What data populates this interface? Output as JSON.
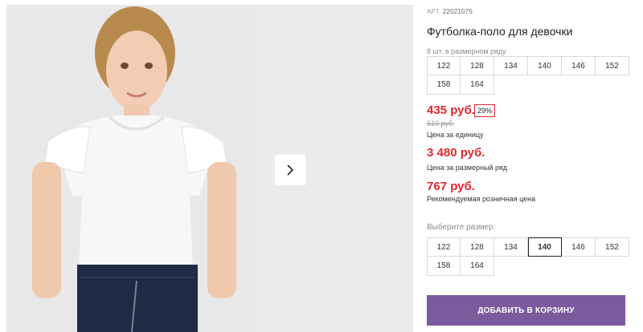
{
  "gallery": {
    "main_image_label": "Девочка в белой футболке-поло",
    "next_arrow_icon": "chevron-right-icon"
  },
  "product": {
    "article_label": "АРТ.",
    "article_number": "22021075",
    "title": "Футболка-поло для девочки",
    "series_note": "8 шт. в размерном ряду",
    "series_sizes": [
      "122",
      "128",
      "134",
      "140",
      "146",
      "152",
      "158",
      "164"
    ]
  },
  "pricing": {
    "price": "435 руб.",
    "discount": "29%",
    "old_price": "610 руб.",
    "unit_note": "Цена за единицу",
    "series_price": "3 480 руб.",
    "series_note": "Цена за размерный ряд",
    "retail_price": "767 руб.",
    "retail_note": "Рекомендуемая розничная цена"
  },
  "size_select": {
    "label": "Выберите размер:",
    "sizes": [
      "122",
      "128",
      "134",
      "140",
      "146",
      "152",
      "158",
      "164"
    ],
    "selected": "140"
  },
  "cart": {
    "add_label": "ДОБАВИТЬ В КОРЗИНУ"
  },
  "colors": {
    "price_red": "#e3262f",
    "button_purple": "#7b5a9e"
  }
}
